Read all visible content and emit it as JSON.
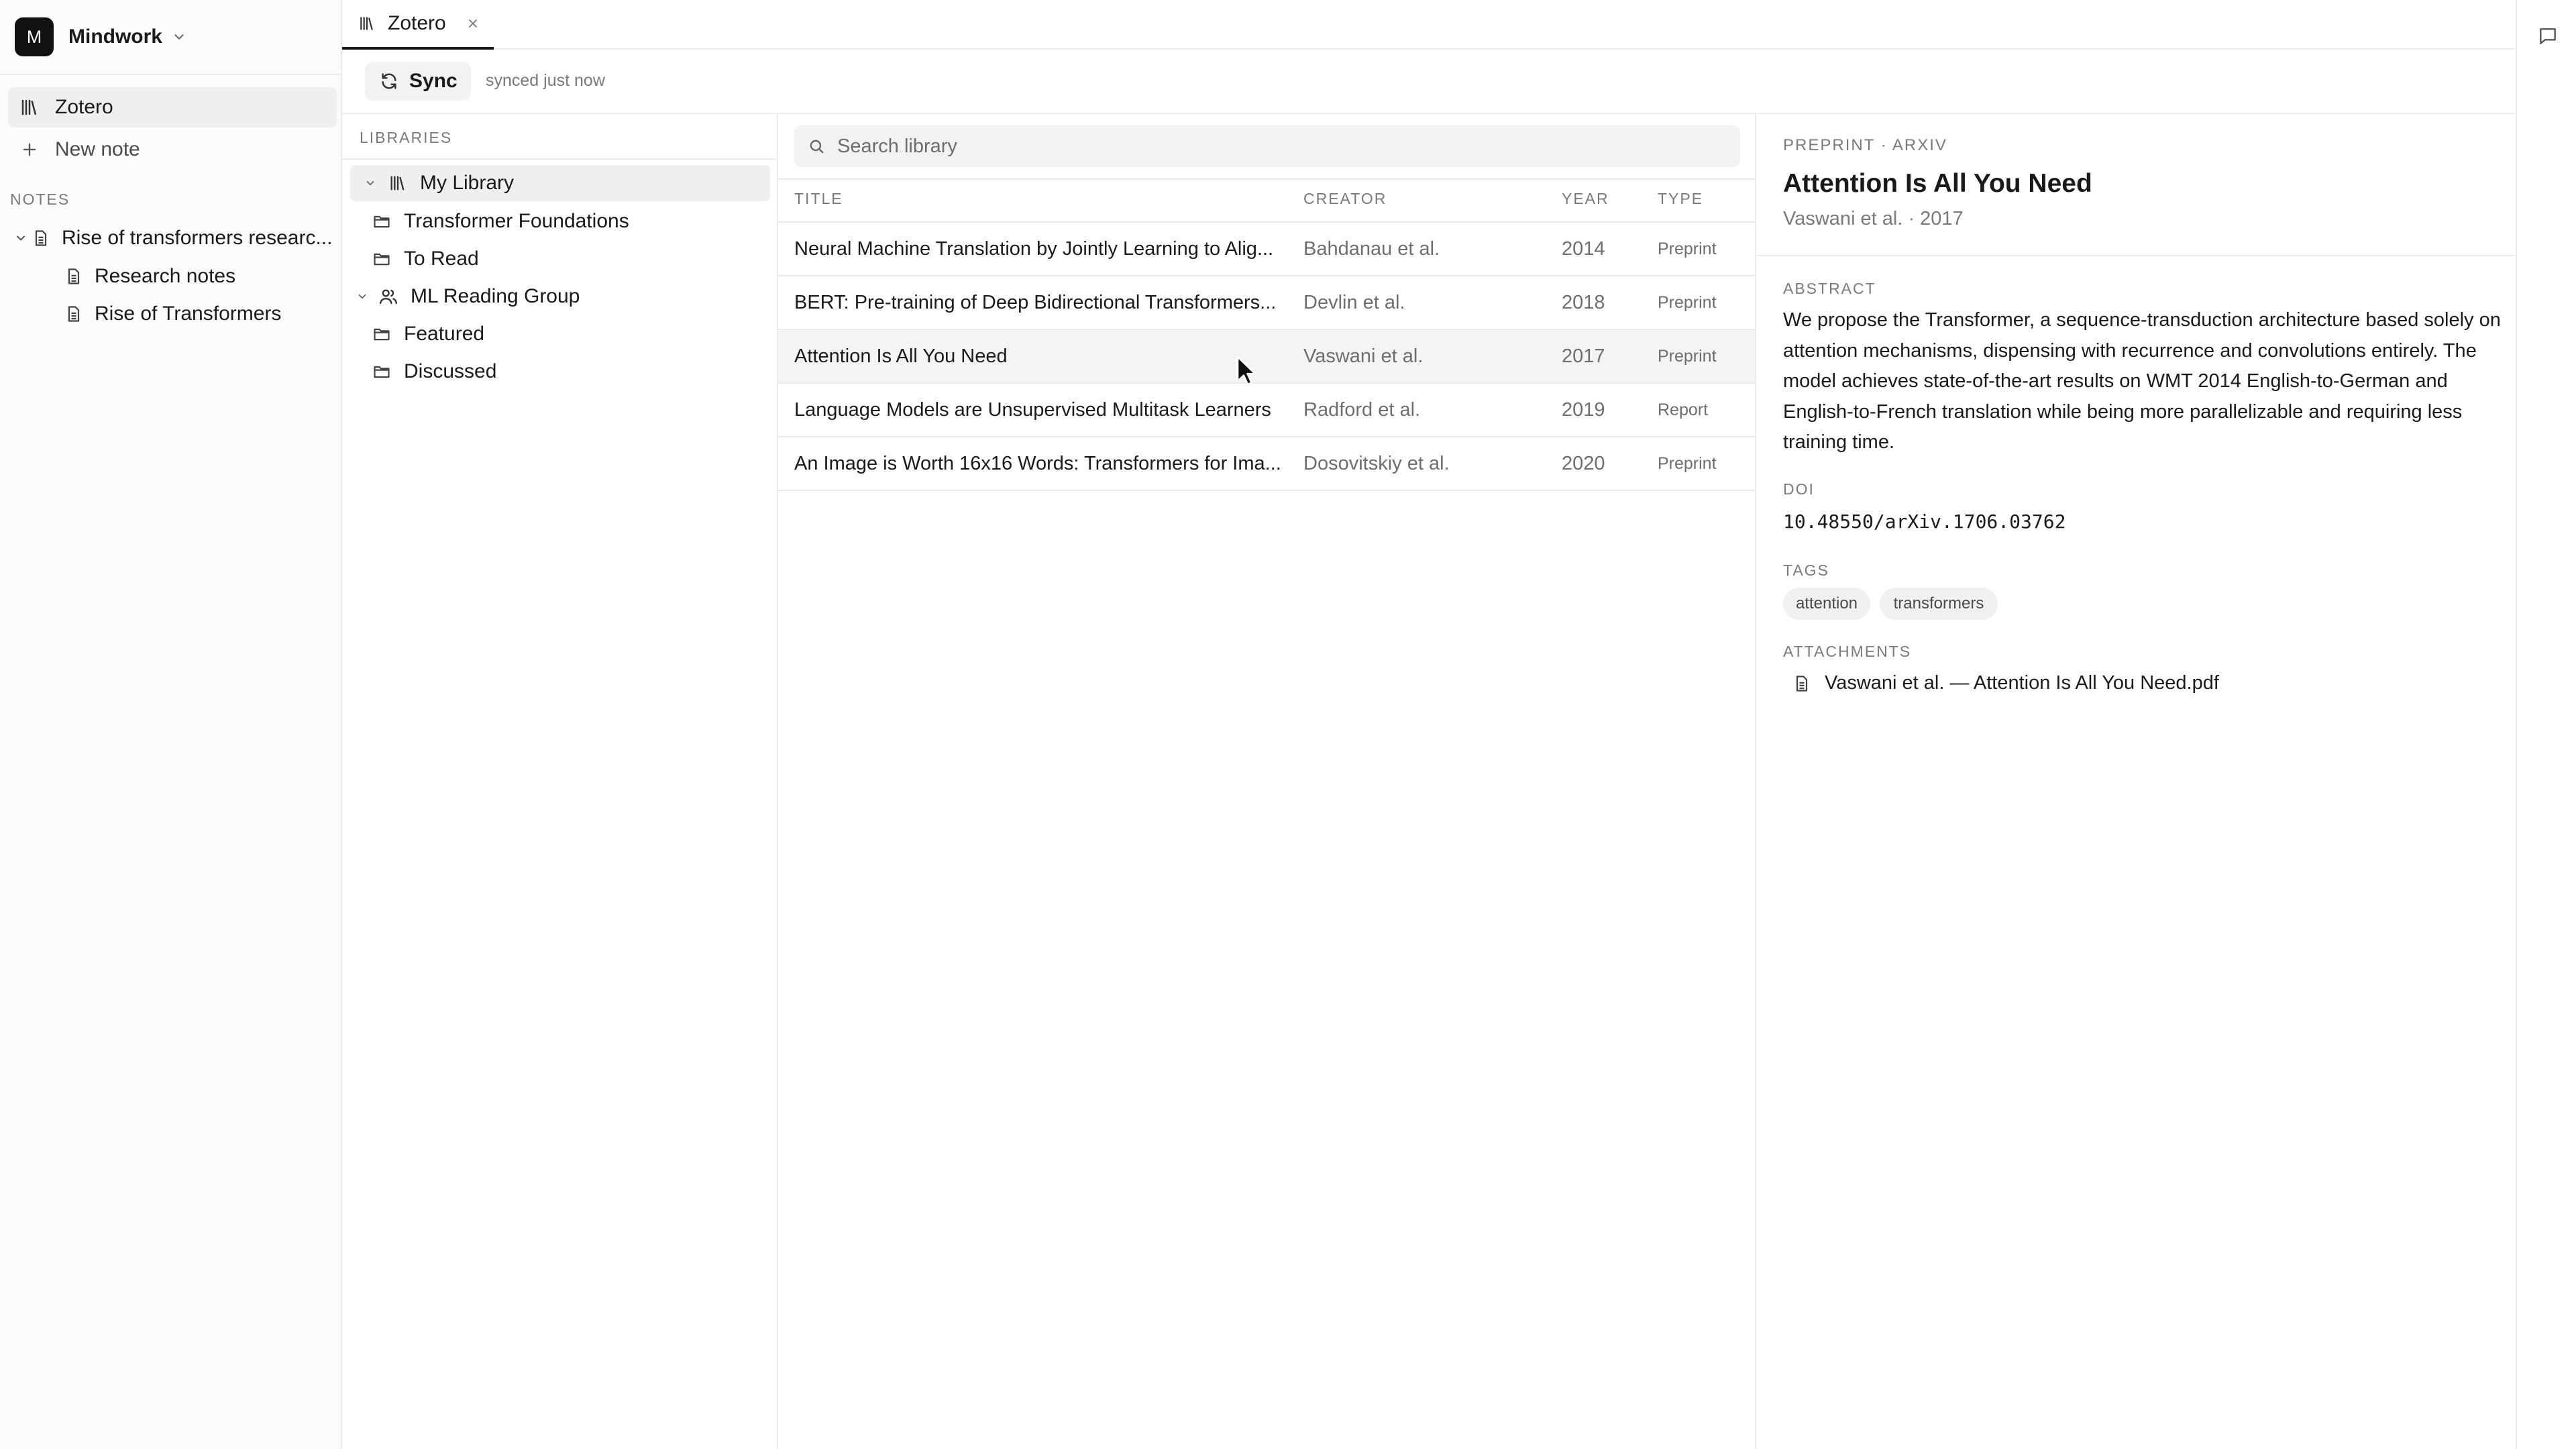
{
  "workspace": {
    "initial": "M",
    "name": "Mindwork"
  },
  "sidebar": {
    "zotero_label": "Zotero",
    "new_note_label": "New note",
    "notes_section_label": "NOTES",
    "notes": [
      {
        "label": "Rise of transformers researc..."
      },
      {
        "label": "Research notes"
      },
      {
        "label": "Rise of Transformers"
      }
    ]
  },
  "tabs": [
    {
      "label": "Zotero"
    }
  ],
  "toolbar": {
    "sync_label": "Sync",
    "sync_status": "synced just now"
  },
  "libraries": {
    "section_label": "LIBRARIES",
    "items": [
      {
        "label": "My Library"
      },
      {
        "label": "Transformer Foundations"
      },
      {
        "label": "To Read"
      },
      {
        "label": "ML Reading Group"
      },
      {
        "label": "Featured"
      },
      {
        "label": "Discussed"
      }
    ]
  },
  "search": {
    "placeholder": "Search library",
    "value": ""
  },
  "table": {
    "columns": {
      "title": "TITLE",
      "creator": "CREATOR",
      "year": "YEAR",
      "type": "TYPE"
    },
    "rows": [
      {
        "title": "Neural Machine Translation by Jointly Learning to Alig...",
        "creator": "Bahdanau et al.",
        "year": "2014",
        "type": "Preprint"
      },
      {
        "title": "BERT: Pre-training of Deep Bidirectional Transformers...",
        "creator": "Devlin et al.",
        "year": "2018",
        "type": "Preprint"
      },
      {
        "title": "Attention Is All You Need",
        "creator": "Vaswani et al.",
        "year": "2017",
        "type": "Preprint"
      },
      {
        "title": "Language Models are Unsupervised Multitask Learners",
        "creator": "Radford et al.",
        "year": "2019",
        "type": "Report"
      },
      {
        "title": "An Image is Worth 16x16 Words: Transformers for Ima...",
        "creator": "Dosovitskiy et al.",
        "year": "2020",
        "type": "Preprint"
      }
    ],
    "selected_index": 2
  },
  "detail": {
    "eyebrow": "PREPRINT · ARXIV",
    "title": "Attention Is All You Need",
    "meta": "Vaswani et al. · 2017",
    "abstract_label": "ABSTRACT",
    "abstract": "We propose the Transformer, a sequence-transduction architecture based solely on attention mechanisms, dispensing with recurrence and convolutions entirely. The model achieves state-of-the-art results on WMT 2014 English-to-German and English-to-French translation while being more parallelizable and requiring less training time.",
    "doi_label": "DOI",
    "doi": "10.48550/arXiv.1706.03762",
    "tags_label": "TAGS",
    "tags": [
      "attention",
      "transformers"
    ],
    "attachments_label": "ATTACHMENTS",
    "attachments": [
      {
        "name": "Vaswani et al. — Attention Is All You Need.pdf"
      }
    ]
  }
}
